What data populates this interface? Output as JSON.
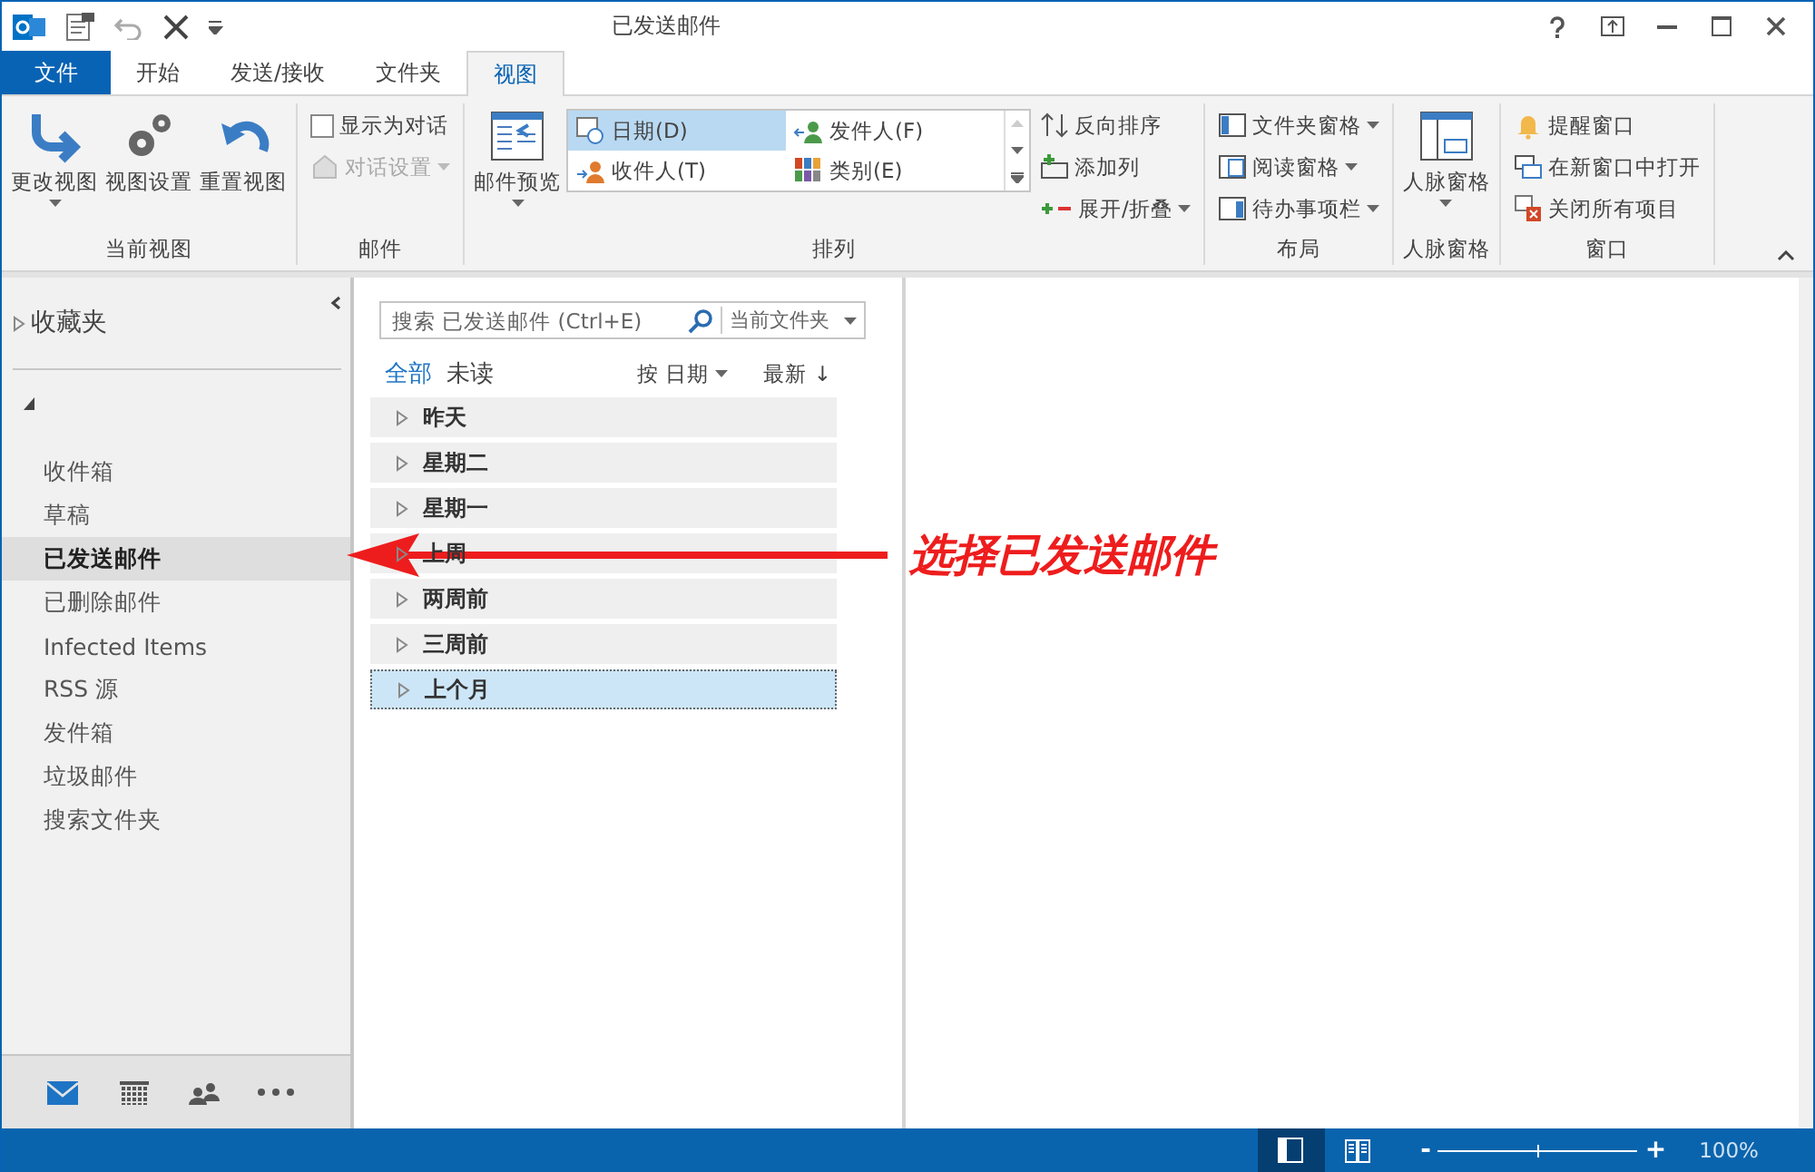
{
  "window": {
    "title": "已发送邮件"
  },
  "tabs": [
    {
      "label": "文件",
      "kind": "file",
      "selected": false
    },
    {
      "label": "开始",
      "kind": "tab",
      "selected": false
    },
    {
      "label": "发送/接收",
      "kind": "tab",
      "selected": false
    },
    {
      "label": "文件夹",
      "kind": "tab",
      "selected": false
    },
    {
      "label": "视图",
      "kind": "tab",
      "selected": true
    }
  ],
  "ribbon": {
    "groups": [
      {
        "label": "当前视图",
        "items": [
          {
            "kind": "large",
            "label": "更改视图",
            "dropdown": true
          },
          {
            "kind": "large",
            "label": "视图设置",
            "dropdown": false
          },
          {
            "kind": "large",
            "label": "重置视图",
            "dropdown": false
          }
        ]
      },
      {
        "label": "邮件",
        "items": [
          {
            "kind": "stack",
            "items": [
              {
                "kind": "checkbox",
                "label": "显示为对话",
                "checked": false
              },
              {
                "kind": "small",
                "label": "对话设置",
                "dropdown": true,
                "disabled": true
              }
            ]
          }
        ]
      },
      {
        "label": "排列",
        "items": [
          {
            "kind": "large",
            "label": "邮件预览",
            "dropdown": true
          },
          {
            "kind": "gallery",
            "options": [
              {
                "label": "日期(D)",
                "selected": true
              },
              {
                "label": "发件人(F)",
                "selected": false
              },
              {
                "label": "收件人(T)",
                "selected": false
              },
              {
                "label": "类别(E)",
                "selected": false
              }
            ]
          },
          {
            "kind": "stack",
            "items": [
              {
                "kind": "small",
                "label": "反向排序",
                "dropdown": false,
                "disabled": false
              },
              {
                "kind": "small",
                "label": "添加列",
                "dropdown": false,
                "disabled": false
              },
              {
                "kind": "small",
                "label": "展开/折叠",
                "dropdown": true,
                "disabled": false
              }
            ]
          }
        ]
      },
      {
        "label": "布局",
        "items": [
          {
            "kind": "stack",
            "items": [
              {
                "kind": "small",
                "label": "文件夹窗格",
                "dropdown": true,
                "disabled": false
              },
              {
                "kind": "small",
                "label": "阅读窗格",
                "dropdown": true,
                "disabled": false
              },
              {
                "kind": "small",
                "label": "待办事项栏",
                "dropdown": true,
                "disabled": false
              }
            ]
          }
        ]
      },
      {
        "label": "人脉窗格",
        "items": [
          {
            "kind": "large",
            "label": "人脉窗格",
            "dropdown": true
          }
        ]
      },
      {
        "label": "窗口",
        "items": [
          {
            "kind": "stack",
            "items": [
              {
                "kind": "small",
                "label": "提醒窗口",
                "dropdown": false,
                "disabled": false
              },
              {
                "kind": "small",
                "label": "在新窗口中打开",
                "dropdown": false,
                "disabled": false
              },
              {
                "kind": "small",
                "label": "关闭所有项目",
                "dropdown": false,
                "disabled": false
              }
            ]
          }
        ]
      }
    ]
  },
  "sidebar": {
    "favorites": {
      "label": "收藏夹",
      "expanded": false
    },
    "account": {
      "expanded": true
    },
    "items": [
      {
        "label": "收件箱",
        "selected": false
      },
      {
        "label": "草稿",
        "selected": false
      },
      {
        "label": "已发送邮件",
        "selected": true
      },
      {
        "label": "已删除邮件",
        "selected": false
      },
      {
        "label": "Infected Items",
        "selected": false
      },
      {
        "label": "RSS 源",
        "selected": false
      },
      {
        "label": "发件箱",
        "selected": false
      },
      {
        "label": "垃圾邮件",
        "selected": false
      },
      {
        "label": "搜索文件夹",
        "selected": false
      }
    ],
    "modules": [
      {
        "kind": "mail",
        "selected": true
      },
      {
        "kind": "calendar",
        "selected": false
      },
      {
        "kind": "people",
        "selected": false
      },
      {
        "kind": "more",
        "selected": false
      }
    ]
  },
  "message_list": {
    "search": {
      "placeholder": "搜索 已发送邮件 (Ctrl+E)",
      "scope": "当前文件夹"
    },
    "filters": [
      {
        "label": "全部",
        "selected": true
      },
      {
        "label": "未读",
        "selected": false
      }
    ],
    "sort": {
      "by": "按 日期",
      "order": "最新 ↓"
    },
    "groups": [
      {
        "label": "昨天",
        "selected": false
      },
      {
        "label": "星期二",
        "selected": false
      },
      {
        "label": "星期一",
        "selected": false
      },
      {
        "label": "上周",
        "selected": false
      },
      {
        "label": "两周前",
        "selected": false
      },
      {
        "label": "三周前",
        "selected": false
      },
      {
        "label": "上个月",
        "selected": true
      }
    ]
  },
  "annotation": {
    "text": "选择已发送邮件"
  },
  "status_bar": {
    "views": [
      {
        "kind": "normal",
        "selected": true
      },
      {
        "kind": "reading",
        "selected": false
      }
    ],
    "zoom": {
      "out": "-",
      "level": 0.5,
      "in": "+",
      "reading": "100%"
    }
  }
}
